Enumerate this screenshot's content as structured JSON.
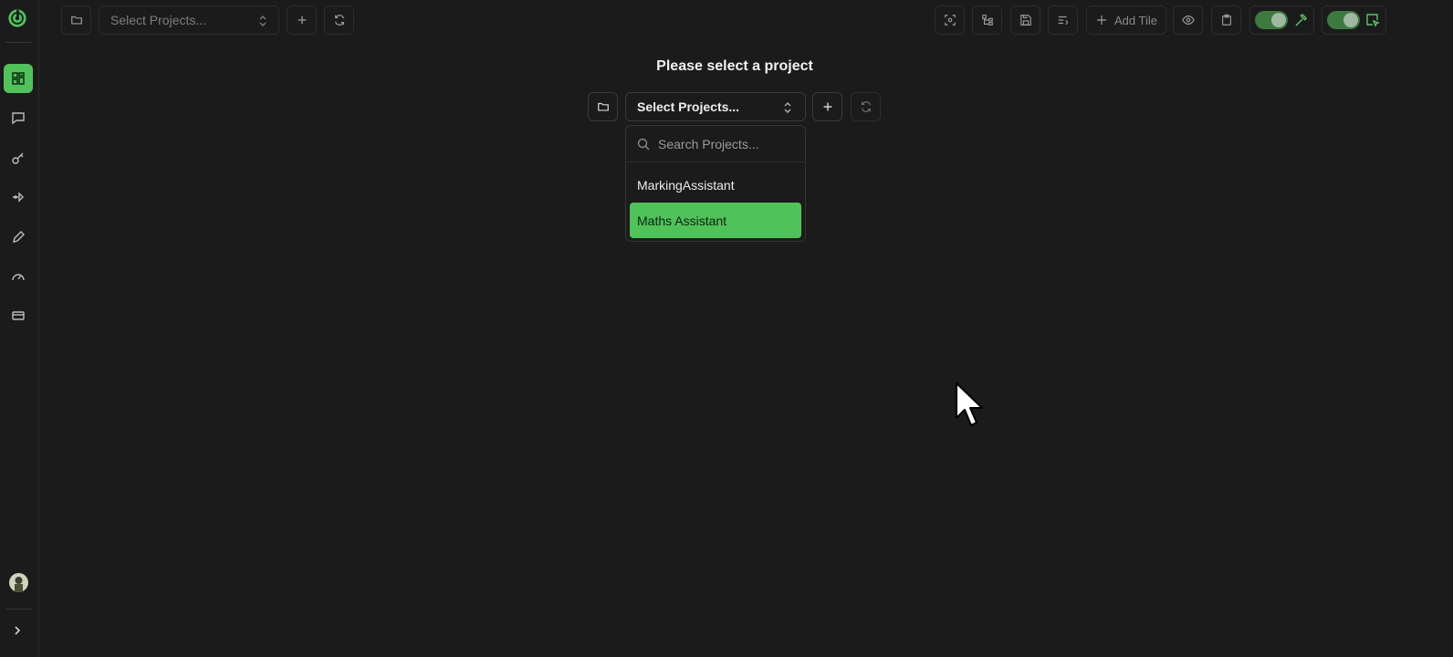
{
  "toolbar": {
    "project_select_placeholder": "Select Projects...",
    "add_tile_label": "Add Tile"
  },
  "main": {
    "title": "Please select a project",
    "project_select_label": "Select Projects...",
    "dropdown": {
      "search_placeholder": "Search Projects...",
      "items": [
        {
          "label": "MarkingAssistant",
          "selected": false
        },
        {
          "label": "Maths Assistant",
          "selected": true
        }
      ]
    }
  },
  "sidebar": {
    "items": [
      {
        "icon": "dashboard-icon",
        "active": true
      },
      {
        "icon": "chat-icon",
        "active": false
      },
      {
        "icon": "key-icon",
        "active": false
      },
      {
        "icon": "route-icon",
        "active": false
      },
      {
        "icon": "pen-icon",
        "active": false
      },
      {
        "icon": "gauge-icon",
        "active": false
      },
      {
        "icon": "card-icon",
        "active": false
      }
    ]
  },
  "colors": {
    "accent": "#4fc25a",
    "background": "#1b1b1c"
  }
}
